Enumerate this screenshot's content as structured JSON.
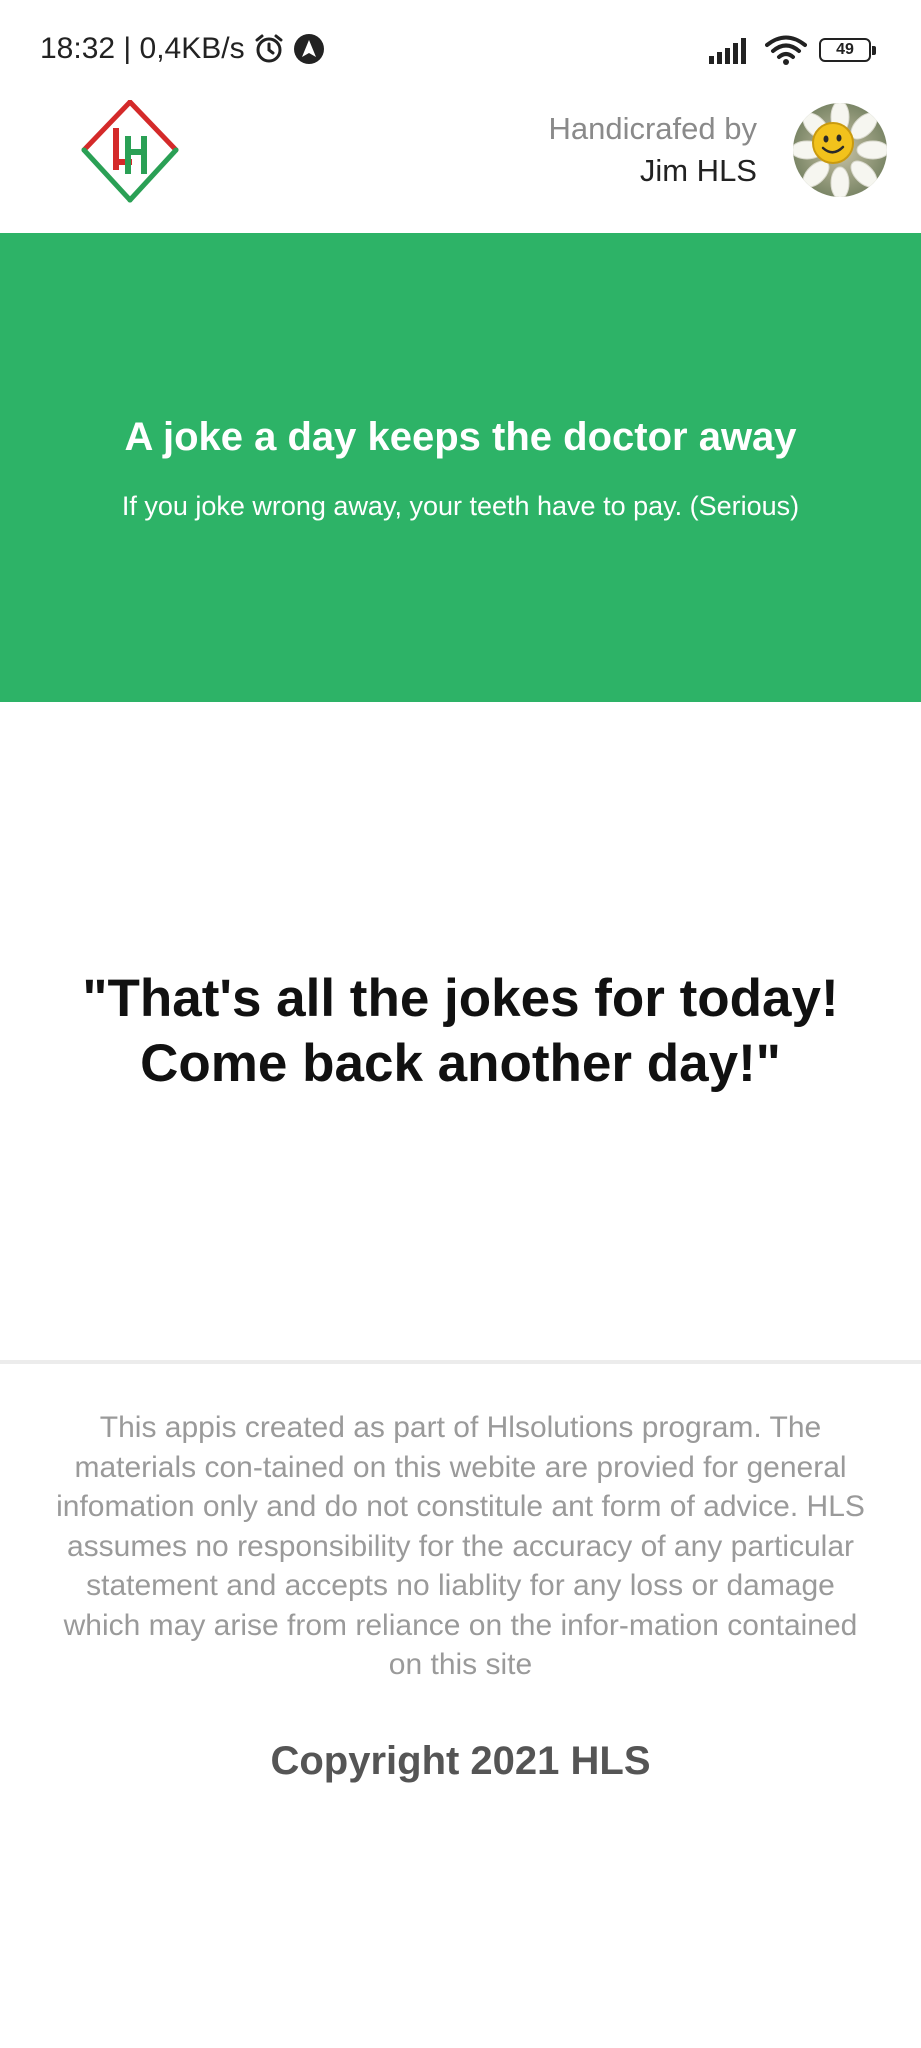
{
  "status_bar": {
    "time_speed": "18:32 | 0,4KB/s",
    "alarm_icon": "alarm-clock-icon",
    "nav_icon": "navigation-arrow-icon",
    "signal_icon": "cellular-signal-icon",
    "wifi_icon": "wifi-icon",
    "battery_level": "49"
  },
  "header": {
    "logo_icon": "hls-logo",
    "credit_label": "Handicrafed by",
    "credit_name": "Jim HLS",
    "avatar_icon": "smiley-flower-avatar"
  },
  "banner": {
    "title": "A joke a day keeps the doctor away",
    "subtitle": "If you joke wrong away, your teeth have to pay. (Serious)",
    "background_color": "#2db367"
  },
  "main": {
    "message_line1": "\"That's all the jokes for today!",
    "message_line2": "Come back another day!\""
  },
  "footer": {
    "disclaimer": "This appis created as part of Hlsolutions program. The materials con-tained on this webite are provied for general infomation only and do not constitule ant form of advice. HLS assumes no responsibility for the accuracy of any particular statement and accepts no liablity for any loss or damage which may arise from reliance on the infor-mation contained on this site",
    "copyright": "Copyright 2021 HLS"
  }
}
